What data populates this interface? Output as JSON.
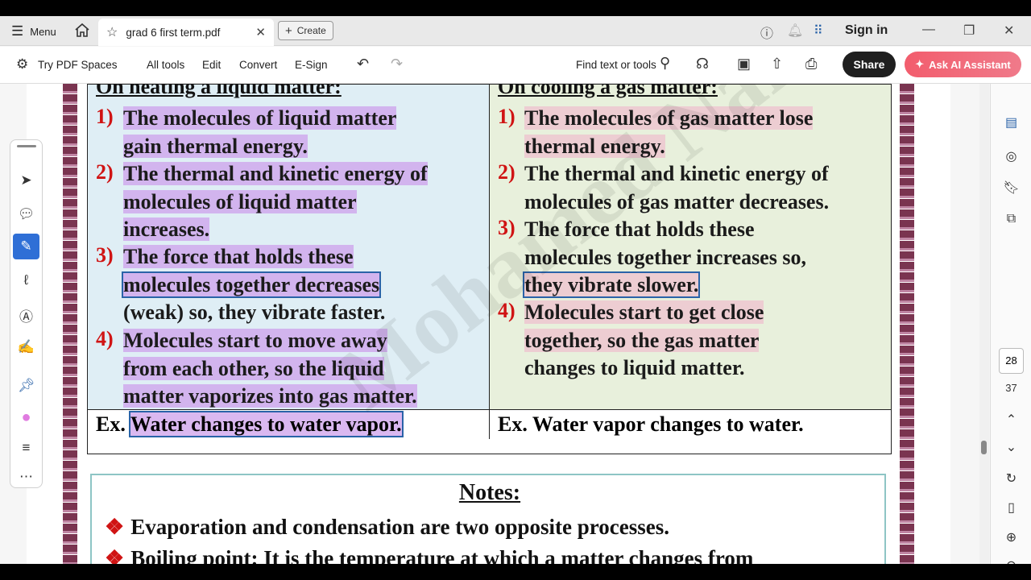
{
  "tabbar": {
    "menu_label": "Menu",
    "tab_title": "grad 6 first term.pdf",
    "create_label": "Create",
    "sign_in": "Sign in"
  },
  "toolbar": {
    "try_pdf_spaces": "Try PDF Spaces",
    "all_tools": "All tools",
    "edit": "Edit",
    "convert": "Convert",
    "esign": "E-Sign",
    "find": "Find text or tools",
    "share": "Share",
    "ai_assistant": "Ask AI Assistant"
  },
  "document": {
    "left_heading": "On heating a liquid matter:",
    "right_heading": "On cooling a gas matter:",
    "left_items": [
      {
        "num": "1)",
        "lines": [
          "The molecules of liquid matter",
          "gain thermal energy."
        ]
      },
      {
        "num": "2)",
        "lines": [
          "The thermal and kinetic energy of",
          "molecules of liquid matter",
          "increases."
        ]
      },
      {
        "num": "3)",
        "lines": [
          "The force that holds these",
          "molecules together decreases",
          "(weak) so, they vibrate faster."
        ]
      },
      {
        "num": "4)",
        "lines": [
          "Molecules start to move away",
          "from each other, so the liquid",
          "matter vaporizes into gas matter."
        ]
      }
    ],
    "right_items": [
      {
        "num": "1)",
        "lines": [
          "The molecules of gas matter lose",
          "thermal energy."
        ]
      },
      {
        "num": "2)",
        "lines": [
          "The thermal and kinetic energy of",
          "molecules of gas matter decreases."
        ]
      },
      {
        "num": "3)",
        "lines": [
          "The force that holds these",
          "molecules together increases so,",
          "they vibrate slower."
        ]
      },
      {
        "num": "4)",
        "lines": [
          "Molecules start to get close",
          "together, so the gas matter",
          "changes to liquid matter."
        ]
      }
    ],
    "ex_left_prefix": "Ex.",
    "ex_left": "Water changes to water vapor.",
    "ex_right": "Ex. Water vapor changes to water.",
    "notes_title": "Notes:",
    "note1": "Evaporation and condensation are two opposite processes.",
    "note2_term": "Boiling point",
    "note2_rest": ": It is the temperature at which a matter changes from",
    "watermark": "Mohamed Nafea"
  },
  "sidepanel": {
    "current_page": "28",
    "total_pages": "37"
  }
}
